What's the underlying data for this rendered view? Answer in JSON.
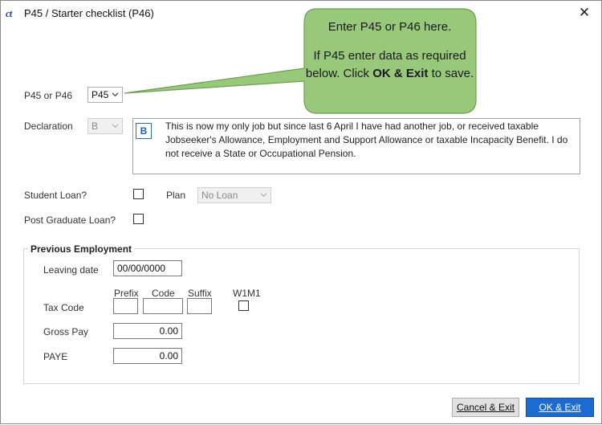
{
  "window": {
    "logo_text": "ct",
    "title": "P45 / Starter checklist (P46)",
    "close_glyph": "✕"
  },
  "callout": {
    "line1": "Enter P45 or P46 here.",
    "line2_pre": "If P45 enter data as required below. Click",
    "line2_bold": "OK & Exit",
    "line2_post": "to save.",
    "fill_color": "#98c97a",
    "border_color": "#6f9c55"
  },
  "form": {
    "p45_label": "P45 or P46",
    "p45_value": "P45",
    "declaration_label": "Declaration",
    "declaration_value": "B",
    "declaration_badge": "B",
    "declaration_text": "This is now my only job but since last 6 April I have had another job, or received taxable Jobseeker's Allowance, Employment and Support Allowance or taxable Incapacity Benefit. I do not receive a State or Occupational Pension.",
    "student_loan_label": "Student Loan?",
    "plan_label": "Plan",
    "plan_value": "No Loan",
    "pg_loan_label": "Post Graduate Loan?"
  },
  "previous_employment": {
    "title": "Previous Employment",
    "leaving_date_label": "Leaving date",
    "leaving_date_value": "00/00/0000",
    "tax_code_label": "Tax Code",
    "prefix_label": "Prefix",
    "code_label": "Code",
    "suffix_label": "Suffix",
    "w1m1_label": "W1M1",
    "gross_pay_label": "Gross Pay",
    "gross_pay_value": "0.00",
    "paye_label": "PAYE",
    "paye_value": "0.00"
  },
  "buttons": {
    "cancel": "Cancel & Exit",
    "ok": "OK & Exit"
  }
}
